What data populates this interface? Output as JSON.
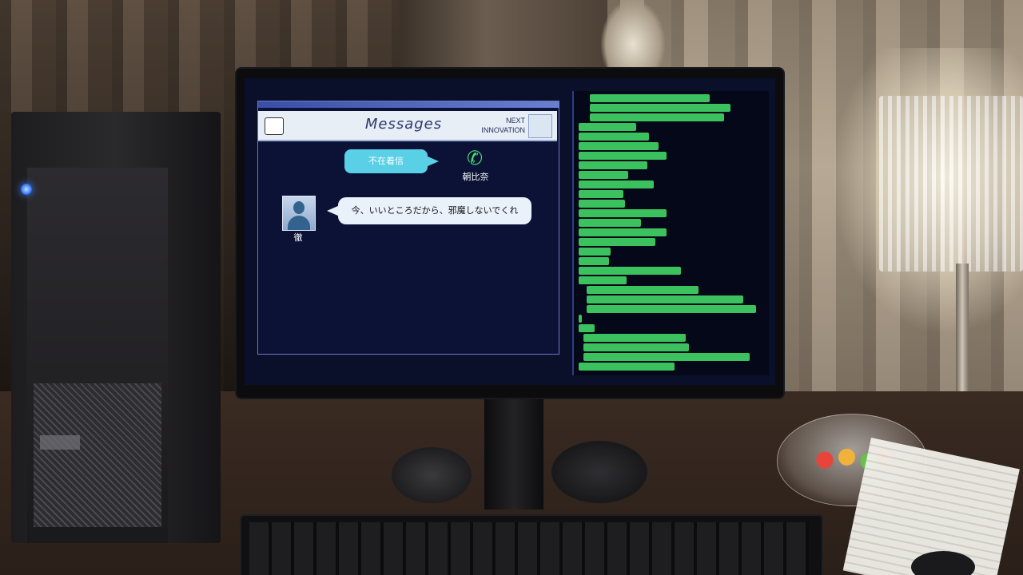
{
  "messages_app": {
    "title": "Messages",
    "brand_line1": "NEXT",
    "brand_line2": "INNOVATION",
    "missed_call_label": "不在着信",
    "caller_name": "朝比奈",
    "sender_name": "徹",
    "message_text": "今、いいところだから、邪魔しないでくれ",
    "phone_icon": "phone-icon",
    "avatar_icon": "user-silhouette-icon"
  },
  "colors": {
    "accent_cyan": "#5ad0e6",
    "terminal_green": "#45e26a",
    "app_background": "#0b1236"
  }
}
